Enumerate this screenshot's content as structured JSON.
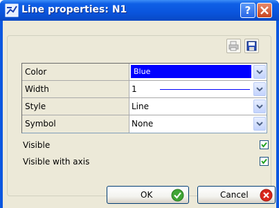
{
  "window": {
    "title": "Line properties: N1",
    "help_button": "?",
    "close_button": "X"
  },
  "toolbar": {
    "print_icon": "print-icon",
    "save_icon": "save-icon"
  },
  "properties": [
    {
      "label": "Color",
      "value": "Blue"
    },
    {
      "label": "Width",
      "value": "1"
    },
    {
      "label": "Style",
      "value": "Line"
    },
    {
      "label": "Symbol",
      "value": "None"
    }
  ],
  "options": {
    "visible": {
      "label": "Visible",
      "checked": true
    },
    "visible_with_axis": {
      "label": "Visible with axis",
      "checked": true
    }
  },
  "buttons": {
    "ok": "OK",
    "cancel": "Cancel"
  },
  "colors": {
    "title_bar": "#0a55dd",
    "dialog_bg": "#ece9d8",
    "selected_color": "#0000ff",
    "ok_icon": "#3fa535",
    "cancel_icon": "#d9261c"
  }
}
